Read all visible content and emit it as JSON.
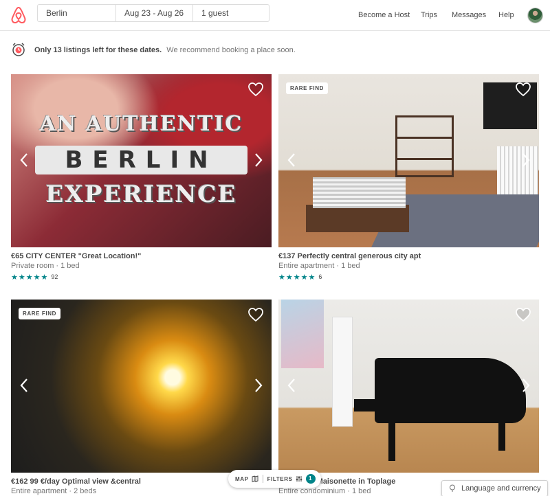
{
  "header": {
    "search": {
      "location": "Berlin",
      "dates": "Aug 23 - Aug 26",
      "guests": "1 guest"
    },
    "nav": {
      "host": "Become a Host",
      "trips": "Trips",
      "messages": "Messages",
      "help": "Help"
    }
  },
  "alert": {
    "strong": "Only 13 listings left for these dates.",
    "sub": "We recommend booking a place soon."
  },
  "listings": [
    {
      "title": "€65 CITY CENTER \"Great Location!\"",
      "meta": "Private room · 1 bed",
      "stars": "★★★★★",
      "rating": 4.5,
      "reviews": "92",
      "overlay": [
        "AN AUTHENTIC",
        "BERLIN",
        "EXPERIENCE"
      ]
    },
    {
      "badge": "RARE FIND",
      "title": "€137 Perfectly central generous city apt",
      "meta": "Entire apartment · 1 bed",
      "stars": "★★★★★",
      "rating": 4.5,
      "reviews": "6"
    },
    {
      "badge": "RARE FIND",
      "title": "€162 99 €/day Optimal view &central",
      "meta": "Entire apartment · 2 beds"
    },
    {
      "title": "€1__ __ne Maisonette in Toplage",
      "meta": "Entire condominium · 1 bed"
    }
  ],
  "pill": {
    "map": "MAP",
    "filters": "FILTERS",
    "filter_count": "1"
  },
  "footer": {
    "language": "Language and currency"
  },
  "colors": {
    "brand": "#FF5A5F",
    "accent": "#008489"
  }
}
